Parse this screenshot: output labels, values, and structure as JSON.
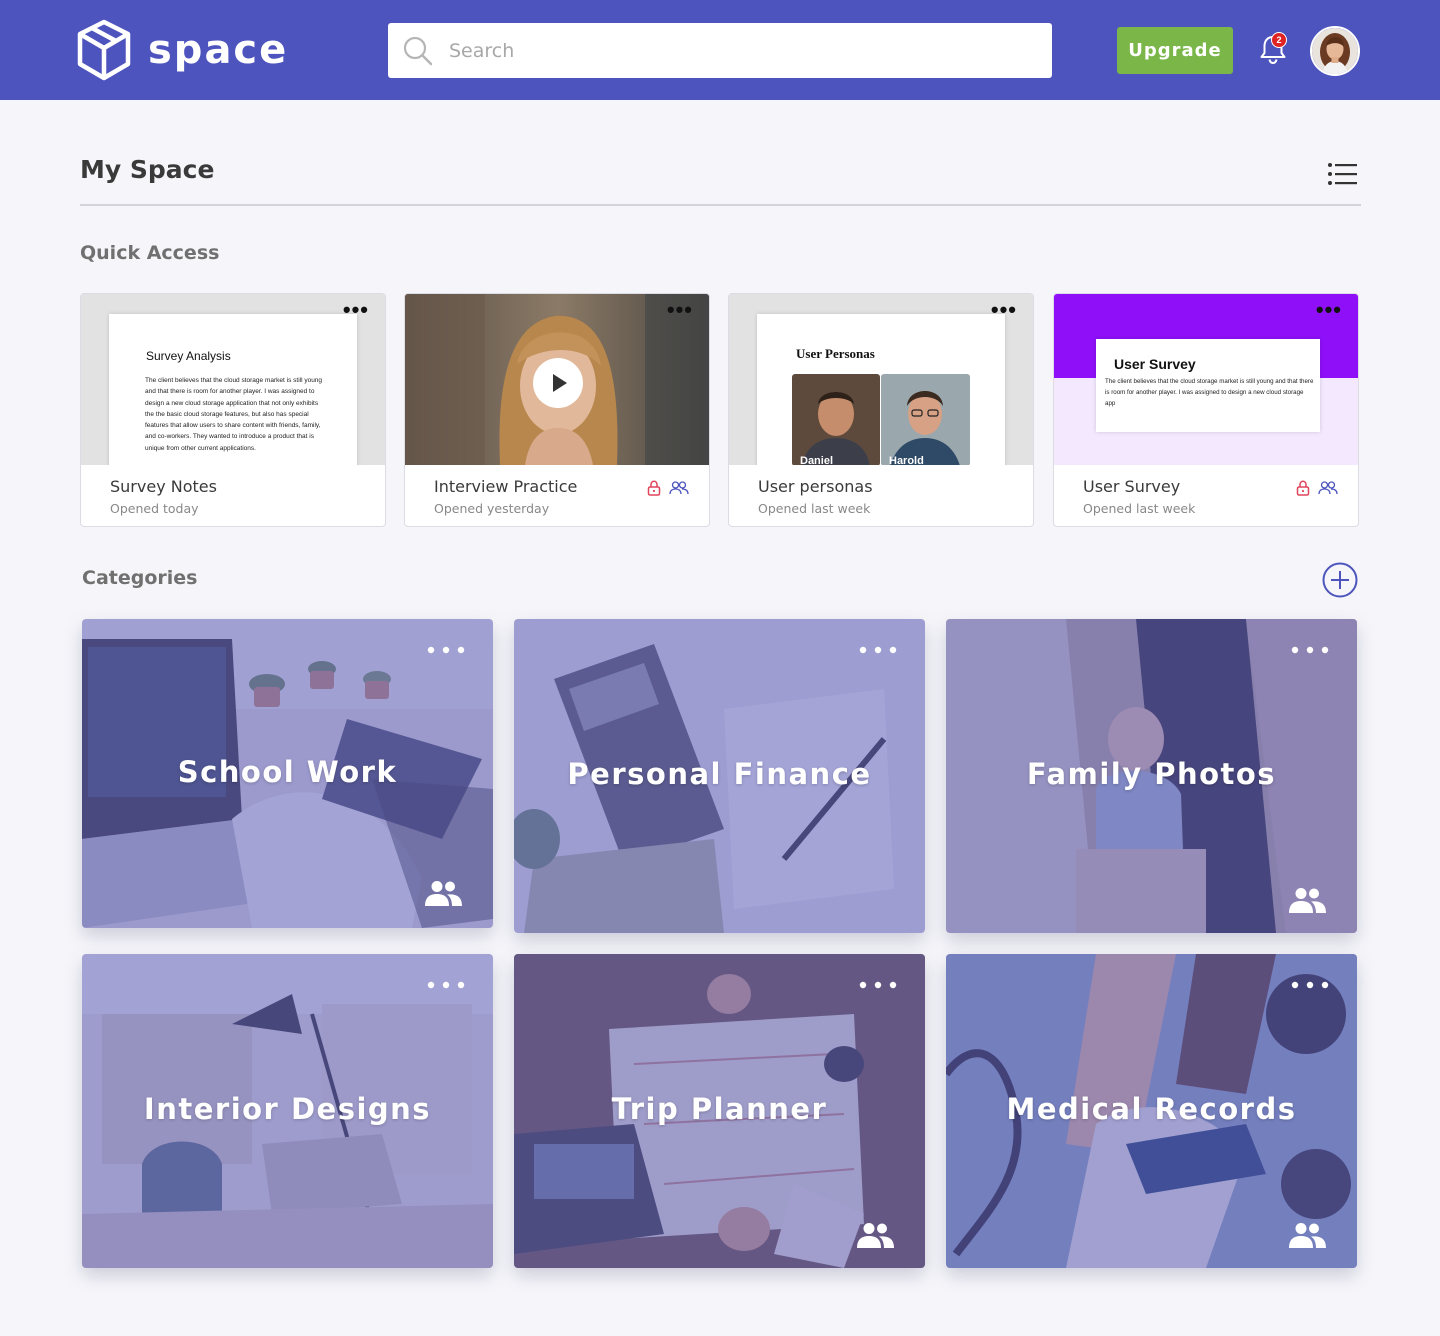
{
  "app": {
    "name": "space"
  },
  "search": {
    "placeholder": "Search"
  },
  "header": {
    "upgrade_label": "Upgrade",
    "notification_count": "2"
  },
  "main": {
    "title": "My Space",
    "quick_access_title": "Quick Access",
    "categories_title": "Categories"
  },
  "quick_access": [
    {
      "name": "Survey Notes",
      "time": "Opened today",
      "thumb_title": "Survey Analysis",
      "thumb_body": "The client believes that the cloud storage market is still young and that there is room for another player. I was assigned to design a new cloud storage application that not only exhibits the the basic cloud storage features, but also has special features that allow users to share content with friends, family, and co-workers. They wanted to introduce a product that is unique from other current applications."
    },
    {
      "name": "Interview Practice",
      "time": "Opened yesterday"
    },
    {
      "name": "User personas",
      "time": "Opened last week",
      "thumb_title": "User Personas",
      "persona_1": "Daniel",
      "persona_2": "Harold"
    },
    {
      "name": "User Survey",
      "time": "Opened last week",
      "thumb_title": "User Survey",
      "thumb_body": "The client believes that the cloud storage market is still young and that there is room for another player. I was assigned to design a new cloud storage app"
    }
  ],
  "categories": [
    {
      "name": "School Work"
    },
    {
      "name": "Personal Finance"
    },
    {
      "name": "Family Photos"
    },
    {
      "name": "Interior Designs"
    },
    {
      "name": "Trip Planner"
    },
    {
      "name": "Medical Records"
    }
  ],
  "icons": {
    "logo": "cube-logo-icon",
    "search": "search-icon",
    "notifications": "bell-icon",
    "view": "list-view-icon",
    "add": "plus-circle-icon",
    "more": "more-horizontal-icon",
    "lock": "lock-icon",
    "shared": "people-icon",
    "play": "play-icon"
  },
  "colors": {
    "header": "#4d54bd",
    "upgrade": "#7ab648",
    "badge": "#e02424",
    "lock": "#e0455b",
    "accent": "#4d54bd",
    "survey_banner": "#8f10f8"
  }
}
